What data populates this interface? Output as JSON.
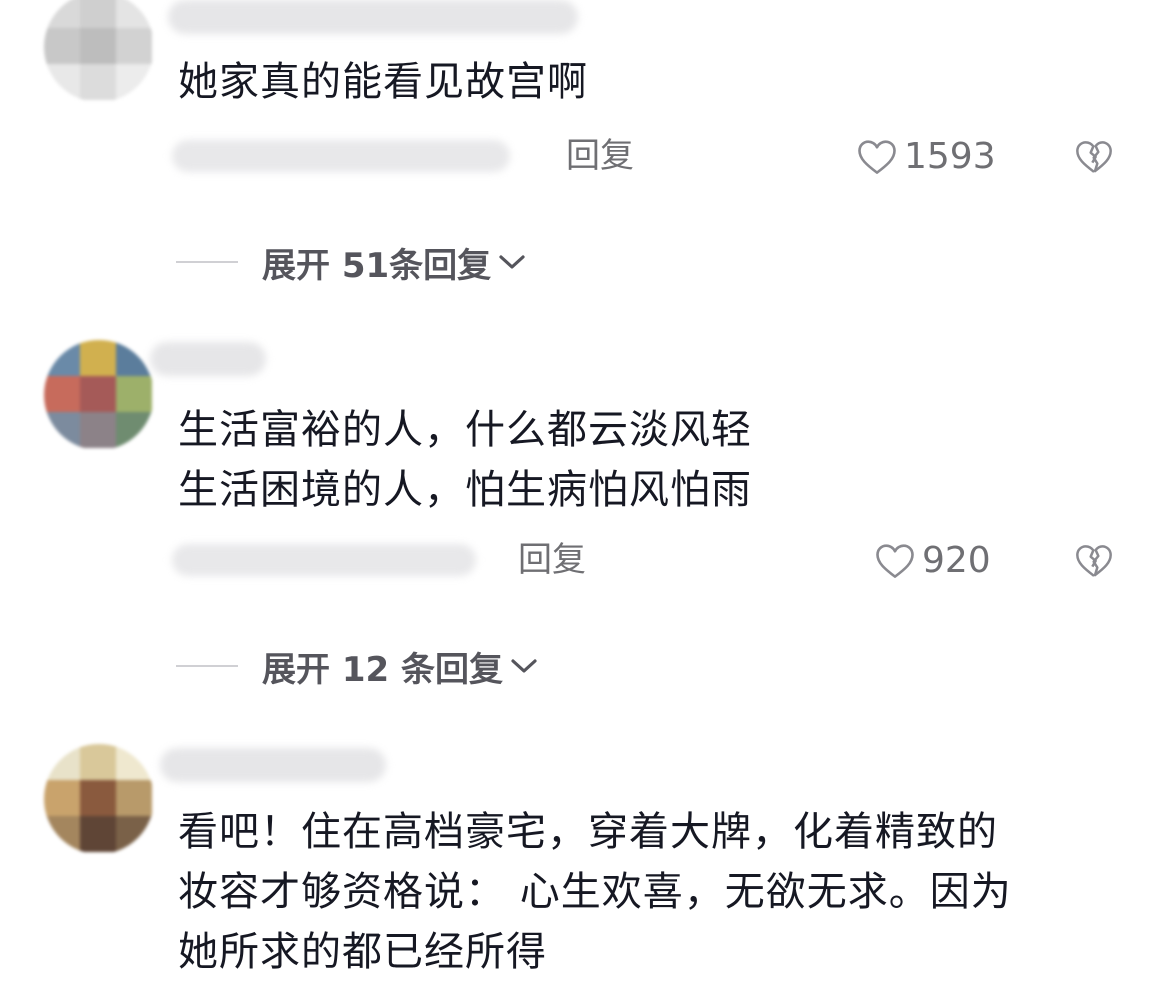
{
  "comments": [
    {
      "text_lines": [
        "她家真的能看见故宫啊"
      ],
      "reply_label": "回复",
      "likes": "1593",
      "expand_label": "展开 51条回复"
    },
    {
      "text_lines": [
        "生活富裕的人，什么都云淡风轻",
        "生活困境的人，怕生病怕风怕雨"
      ],
      "reply_label": "回复",
      "likes": "920",
      "expand_label": "展开 12 条回复"
    },
    {
      "text_lines": [
        "看吧！住在高档豪宅，穿着大牌，化着精致的",
        "妆容才够资格说： 心生欢喜，无欲无求。因为",
        "她所求的都已经所得"
      ]
    }
  ],
  "icons": {
    "like": "heart-outline-icon",
    "dislike": "broken-heart-icon",
    "expand": "chevron-down-icon"
  },
  "colors": {
    "text": "#161823",
    "secondary": "#6f6f73",
    "divider": "#d0d0d4"
  }
}
